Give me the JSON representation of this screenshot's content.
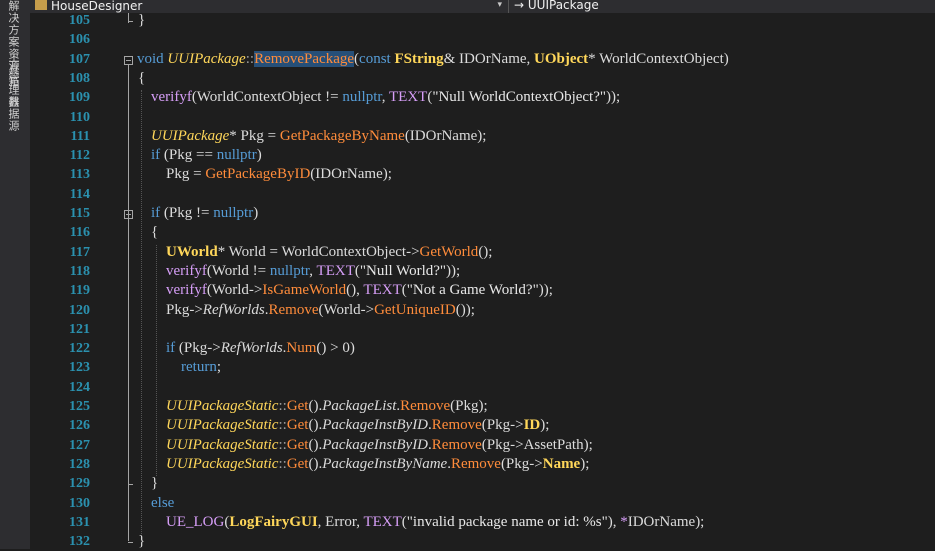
{
  "sidebar": {
    "tabs": [
      "解决方案资源管理器",
      "工具箱",
      "数据源"
    ]
  },
  "navbar": {
    "left_dropdown": "HouseDesigner",
    "right_dropdown": "UUIPackage",
    "right_icon_glyph": "→"
  },
  "line_numbers": [
    "105",
    "106",
    "107",
    "108",
    "109",
    "110",
    "111",
    "112",
    "113",
    "114",
    "115",
    "116",
    "117",
    "118",
    "119",
    "120",
    "121",
    "122",
    "123",
    "124",
    "125",
    "126",
    "127",
    "128",
    "129",
    "130",
    "131",
    "132"
  ],
  "code": {
    "l105": [
      [
        "}",
        "ph"
      ]
    ],
    "l106": [],
    "l107": [
      [
        "void",
        "kw"
      ],
      [
        " ",
        "ph"
      ],
      [
        "UUIPackage",
        "cls"
      ],
      [
        "::",
        "ns"
      ],
      [
        "RemovePackage",
        "fn sel"
      ],
      [
        "(",
        "ph"
      ],
      [
        "const",
        "kw"
      ],
      [
        " ",
        "ph"
      ],
      [
        "FString",
        "uty"
      ],
      [
        "& IDOrName, ",
        "ph"
      ],
      [
        "UObject",
        "uty"
      ],
      [
        "* WorldContextObject)",
        "ph"
      ]
    ],
    "l108": [
      [
        "{",
        "ph"
      ]
    ],
    "l109": [
      [
        "verifyf",
        "mac"
      ],
      [
        "(WorldContextObject != ",
        "ph"
      ],
      [
        "nullptr",
        "kw"
      ],
      [
        ", ",
        "ph"
      ],
      [
        "TEXT",
        "mac"
      ],
      [
        "(",
        "ph"
      ],
      [
        "\"Null WorldContextObject?\"",
        "str"
      ],
      [
        "));",
        "ph"
      ]
    ],
    "l110": [],
    "l111": [
      [
        "UUIPackage",
        "cls"
      ],
      [
        "* Pkg = ",
        "ph"
      ],
      [
        "GetPackageByName",
        "fn cls2"
      ],
      [
        "(IDOrName);",
        "ph"
      ]
    ],
    "l112": [
      [
        "if",
        "kw"
      ],
      [
        " (Pkg == ",
        "ph"
      ],
      [
        "nullptr",
        "kw"
      ],
      [
        ")",
        "ph"
      ]
    ],
    "l113": [
      [
        "    Pkg = ",
        "ph"
      ],
      [
        "GetPackageByID",
        "fn cls2"
      ],
      [
        "(IDOrName);",
        "ph"
      ]
    ],
    "l114": [],
    "l115": [
      [
        "if",
        "kw"
      ],
      [
        " (Pkg != ",
        "ph"
      ],
      [
        "nullptr",
        "kw"
      ],
      [
        ")",
        "ph"
      ]
    ],
    "l116": [
      [
        "{",
        "ph"
      ]
    ],
    "l117": [
      [
        "    ",
        "ph"
      ],
      [
        "UWorld",
        "uty"
      ],
      [
        "* World = WorldContextObject->",
        "ph"
      ],
      [
        "GetWorld",
        "fn"
      ],
      [
        "();",
        "ph"
      ]
    ],
    "l118": [
      [
        "    ",
        "ph"
      ],
      [
        "verifyf",
        "mac"
      ],
      [
        "(World != ",
        "ph"
      ],
      [
        "nullptr",
        "kw"
      ],
      [
        ", ",
        "ph"
      ],
      [
        "TEXT",
        "mac"
      ],
      [
        "(",
        "ph"
      ],
      [
        "\"Null World?\"",
        "str"
      ],
      [
        "));",
        "ph"
      ]
    ],
    "l119": [
      [
        "    ",
        "ph"
      ],
      [
        "verifyf",
        "mac"
      ],
      [
        "(World->",
        "ph"
      ],
      [
        "IsGameWorld",
        "fn"
      ],
      [
        "(), ",
        "ph"
      ],
      [
        "TEXT",
        "mac"
      ],
      [
        "(",
        "ph"
      ],
      [
        "\"Not a Game World?\"",
        "str"
      ],
      [
        "));",
        "ph"
      ]
    ],
    "l120": [
      [
        "    Pkg->",
        "ph"
      ],
      [
        "RefWorlds",
        "mem"
      ],
      [
        ".",
        "ph"
      ],
      [
        "Remove",
        "fn"
      ],
      [
        "(World->",
        "ph"
      ],
      [
        "GetUniqueID",
        "fn"
      ],
      [
        "());",
        "ph"
      ]
    ],
    "l121": [],
    "l122": [
      [
        "    ",
        "ph"
      ],
      [
        "if",
        "kw"
      ],
      [
        " (Pkg->",
        "ph"
      ],
      [
        "RefWorlds",
        "mem"
      ],
      [
        ".",
        "ph"
      ],
      [
        "Num",
        "fn"
      ],
      [
        "() > 0)",
        "ph"
      ]
    ],
    "l123": [
      [
        "        ",
        "ph"
      ],
      [
        "return",
        "kw"
      ],
      [
        ";",
        "ph"
      ]
    ],
    "l124": [],
    "l125": [
      [
        "    ",
        "ph"
      ],
      [
        "UUIPackageStatic",
        "cls"
      ],
      [
        "::",
        "ns"
      ],
      [
        "Get",
        "fn"
      ],
      [
        "().",
        "ph"
      ],
      [
        "PackageList",
        "mem"
      ],
      [
        ".",
        "ph"
      ],
      [
        "Remove",
        "fn"
      ],
      [
        "(Pkg);",
        "ph"
      ]
    ],
    "l126": [
      [
        "    ",
        "ph"
      ],
      [
        "UUIPackageStatic",
        "cls"
      ],
      [
        "::",
        "ns"
      ],
      [
        "Get",
        "fn"
      ],
      [
        "().",
        "ph"
      ],
      [
        "PackageInstByID",
        "mem"
      ],
      [
        ".",
        "ph"
      ],
      [
        "Remove",
        "fn"
      ],
      [
        "(Pkg->",
        "ph"
      ],
      [
        "ID",
        "en"
      ],
      [
        ");",
        "ph"
      ]
    ],
    "l127": [
      [
        "    ",
        "ph"
      ],
      [
        "UUIPackageStatic",
        "cls"
      ],
      [
        "::",
        "ns"
      ],
      [
        "Get",
        "fn"
      ],
      [
        "().",
        "ph"
      ],
      [
        "PackageInstByID",
        "mem"
      ],
      [
        ".",
        "ph"
      ],
      [
        "Remove",
        "fn"
      ],
      [
        "(Pkg->AssetPath);",
        "ph"
      ]
    ],
    "l128": [
      [
        "    ",
        "ph"
      ],
      [
        "UUIPackageStatic",
        "cls"
      ],
      [
        "::",
        "ns"
      ],
      [
        "Get",
        "fn"
      ],
      [
        "().",
        "ph"
      ],
      [
        "PackageInstByName",
        "mem"
      ],
      [
        ".",
        "ph"
      ],
      [
        "Remove",
        "fn"
      ],
      [
        "(Pkg->",
        "ph"
      ],
      [
        "Name",
        "en"
      ],
      [
        ");",
        "ph"
      ]
    ],
    "l129": [
      [
        "}",
        "ph"
      ]
    ],
    "l130": [
      [
        "else",
        "kw"
      ]
    ],
    "l131": [
      [
        "    ",
        "ph"
      ],
      [
        "UE_LOG",
        "mac"
      ],
      [
        "(",
        "ph"
      ],
      [
        "LogFairyGUI",
        "en"
      ],
      [
        ", Error, ",
        "ph"
      ],
      [
        "TEXT",
        "mac"
      ],
      [
        "(",
        "ph"
      ],
      [
        "\"invalid package name or id: %s\"",
        "str"
      ],
      [
        "), ",
        "ph"
      ],
      [
        "*",
        "mac"
      ],
      [
        "IDOrName);",
        "ph"
      ]
    ],
    "l132": [
      [
        "}",
        "ph"
      ]
    ]
  },
  "colors": {
    "background": "#1e1e1e",
    "line_number": "#2b91af",
    "keyword": "#569cd6",
    "function": "#ff8c3b",
    "type": "#ffd75a",
    "macro": "#d69ef7",
    "selection": "#264f78"
  }
}
